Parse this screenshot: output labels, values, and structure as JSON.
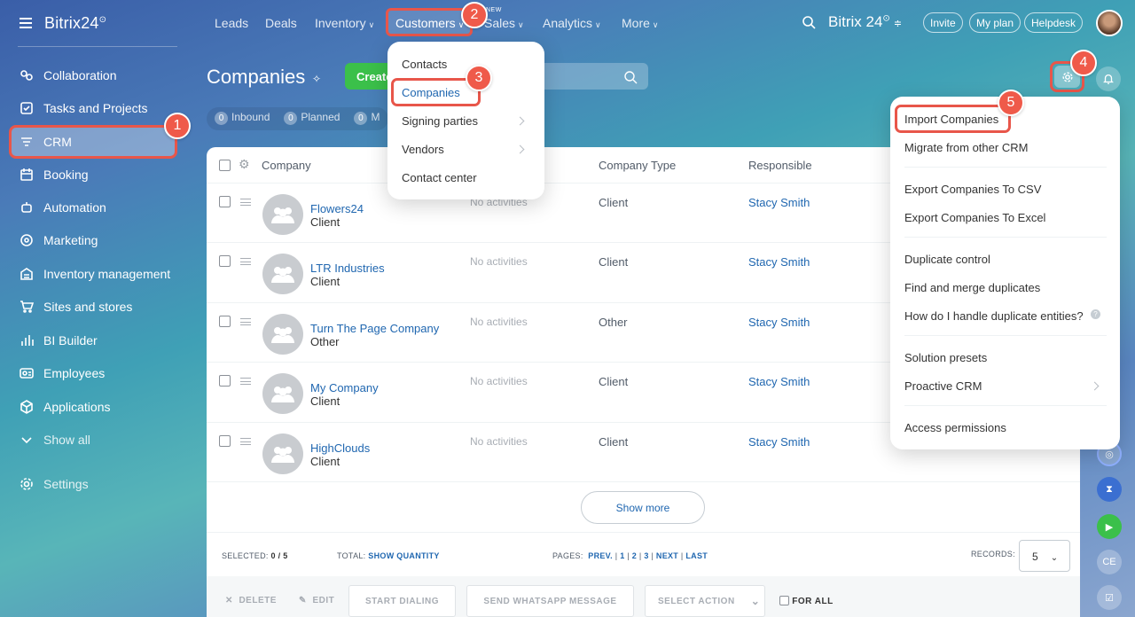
{
  "sidebar": {
    "logo": "Bitrix24",
    "logo_sup": "⊙",
    "items": [
      {
        "label": "Collaboration",
        "icon": "collaboration-icon"
      },
      {
        "label": "Tasks and Projects",
        "icon": "tasks-icon"
      },
      {
        "label": "CRM",
        "icon": "crm-icon"
      },
      {
        "label": "Booking",
        "icon": "booking-icon"
      },
      {
        "label": "Automation",
        "icon": "automation-icon"
      },
      {
        "label": "Marketing",
        "icon": "marketing-icon"
      },
      {
        "label": "Inventory management",
        "icon": "inventory-icon"
      },
      {
        "label": "Sites and stores",
        "icon": "cart-icon"
      },
      {
        "label": "BI Builder",
        "icon": "bi-icon"
      },
      {
        "label": "Employees",
        "icon": "employees-icon"
      },
      {
        "label": "Applications",
        "icon": "applications-icon"
      },
      {
        "label": "Show all",
        "icon": "chevron-down-icon"
      },
      {
        "label": "Settings",
        "icon": "gear-icon"
      }
    ]
  },
  "topnav": {
    "leads": "Leads",
    "deals": "Deals",
    "inventory": "Inventory",
    "customers": "Customers",
    "new_label": "NEW",
    "sales": "Sales",
    "analytics": "Analytics",
    "more": "More",
    "brand": "Bitrix 24",
    "brand_sup": "⊙",
    "invite": "Invite",
    "my_plan": "My plan",
    "helpdesk": "Helpdesk"
  },
  "page": {
    "title": "Companies",
    "create": "Create",
    "counters": [
      {
        "count": "0",
        "label": "Inbound"
      },
      {
        "count": "0",
        "label": "Planned"
      },
      {
        "count": "0",
        "label": "M"
      }
    ]
  },
  "customers_menu": {
    "items": [
      "Contacts",
      "Companies",
      "Signing parties",
      "Vendors",
      "Contact center"
    ]
  },
  "settings_menu": {
    "groups": [
      [
        "Import Companies",
        "Migrate from other CRM"
      ],
      [
        "Export Companies To CSV",
        "Export Companies To Excel"
      ],
      [
        "Duplicate control",
        "Find and merge duplicates",
        "How do I handle duplicate entities?"
      ],
      [
        "Solution presets",
        "Proactive CRM"
      ],
      [
        "Access permissions"
      ]
    ]
  },
  "grid": {
    "headers": {
      "company": "Company",
      "company_type": "Company Type",
      "responsible": "Responsible"
    },
    "rows": [
      {
        "name": "Flowers24",
        "sub": "Client",
        "activity": "No activities",
        "type": "Client",
        "responsible": "Stacy Smith"
      },
      {
        "name": "LTR Industries",
        "sub": "Client",
        "activity": "No activities",
        "type": "Client",
        "responsible": "Stacy Smith"
      },
      {
        "name": "Turn The Page Company",
        "sub": "Other",
        "activity": "No activities",
        "type": "Other",
        "responsible": "Stacy Smith"
      },
      {
        "name": "My Company",
        "sub": "Client",
        "activity": "No activities",
        "type": "Client",
        "responsible": "Stacy Smith"
      },
      {
        "name": "HighClouds",
        "sub": "Client",
        "activity": "No activities",
        "type": "Client",
        "responsible": "Stacy Smith"
      }
    ],
    "show_more": "Show more",
    "footer": {
      "selected_label": "SELECTED:",
      "selected_value": "0 / 5",
      "total_label": "TOTAL:",
      "total_link": "SHOW QUANTITY",
      "pages_label": "PAGES:",
      "prev": "PREV.",
      "p1": "1",
      "p2": "2",
      "p3": "3",
      "next": "NEXT",
      "last": "LAST",
      "records_label": "RECORDS:",
      "records_value": "5"
    },
    "actions": {
      "delete": "DELETE",
      "edit": "EDIT",
      "start_dialing": "START DIALING",
      "send_whatsapp": "SEND WHATSAPP MESSAGE",
      "select_action": "SELECT ACTION",
      "for_all": "FOR ALL"
    }
  },
  "rail": {
    "ce": "CE"
  },
  "callouts": [
    "1",
    "2",
    "3",
    "4",
    "5"
  ],
  "colors": {
    "accent_red": "#e8564a",
    "link_blue": "#2067b0",
    "create_green": "#3bc04a"
  }
}
